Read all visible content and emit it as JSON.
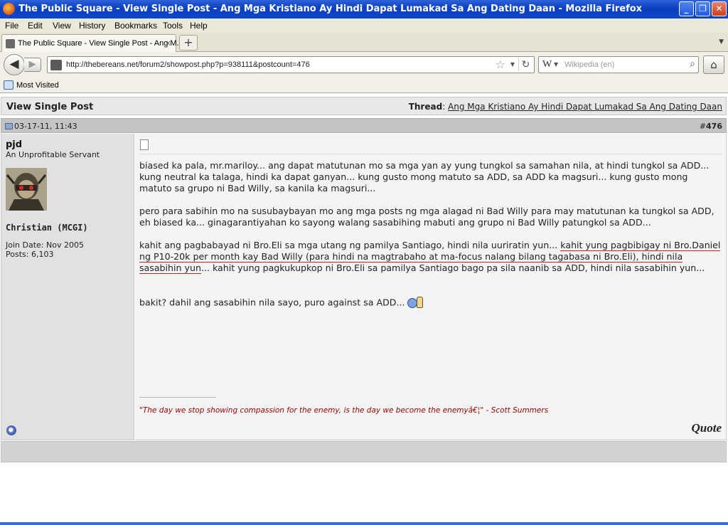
{
  "window": {
    "title": "The Public Square - View Single Post - Ang Mga Kristiano Ay Hindi Dapat Lumakad Sa Ang Dating Daan - Mozilla Firefox",
    "minimize": "_",
    "maximize": "❐",
    "close": "✕"
  },
  "menu": [
    "File",
    "Edit",
    "View",
    "History",
    "Bookmarks",
    "Tools",
    "Help"
  ],
  "tab": {
    "label": "The Public Square - View Single Post - Ang M...",
    "close": "×",
    "new_tab": "+"
  },
  "nav": {
    "url": "http://thebereans.net/forum2/showpost.php?p=938111&postcount=476",
    "search_placeholder": "Wikipedia (en)",
    "search_engine": "W"
  },
  "bookmarks": {
    "most_visited": "Most Visited"
  },
  "page": {
    "header_title": "View Single Post",
    "thread_label": "Thread",
    "thread_title": "Ang Mga Kristiano Ay Hindi Dapat Lumakad Sa Ang Dating Daan",
    "post_date": "03-17-11, 11:43",
    "post_number_prefix": "#",
    "post_number": "476",
    "user": {
      "name": "pjd",
      "title": "An Unprofitable Servant",
      "group": "Christian (MCGI)",
      "join_date": "Join Date: Nov 2005",
      "posts": "Posts: 6,103"
    },
    "post": {
      "p1": "biased ka pala, mr.mariloy... ang dapat matutunan mo sa mga yan ay yung tungkol sa samahan nila, at hindi tungkol sa ADD... kung neutral ka talaga, hindi ka dapat ganyan... kung gusto mong matuto sa ADD, sa ADD ka magsuri... kung gusto mong matuto sa grupo ni Bad Willy, sa kanila ka magsuri...",
      "p2": "pero para sabihin mo na susubaybayan mo ang mga posts ng mga alagad ni Bad Willy para may matutunan ka tungkol sa ADD, eh biased ka... ginagarantiyahan ko sayong walang sasabihing mabuti ang grupo ni Bad Willy patungkol sa ADD...",
      "p3_a": "kahit ang pagbabayad ni Bro.Eli sa mga utang ng pamilya Santiago, hindi nila uuriratin yun... ",
      "p3_underlined": "kahit yung pagbibigay ni Bro.Daniel ng P10-20k per month kay Bad Willy (para hindi na magtrabaho at ma-focus nalang bilang tagabasa ni Bro.Eli), hindi nila sasabihin yun",
      "p3_b": "... kahit yung pagkukupkop ni Bro.Eli sa pamilya Santiago bago pa sila naanib sa ADD, hindi nila sasabihin yun...",
      "p4": "bakit? dahil ang sasabihin nila sayo, puro against sa ADD... "
    },
    "signature": "\"The day we stop showing compassion for the enemy, is the day we become the enemyâ€¦\" - Scott Summers",
    "quote_button": "Quote"
  },
  "colors": {
    "titlebar": "#0a3fbf",
    "signature_text": "#990000",
    "underline": "#cc2222"
  },
  "icons": [
    "firefox-icon",
    "back-arrow-icon",
    "forward-arrow-icon",
    "site-identity-icon",
    "bookmark-star-icon",
    "reload-icon",
    "wikipedia-icon",
    "search-icon",
    "home-icon",
    "most-visited-icon",
    "post-icon",
    "document-icon",
    "smiley-thumbs-up-icon",
    "online-status-icon"
  ]
}
